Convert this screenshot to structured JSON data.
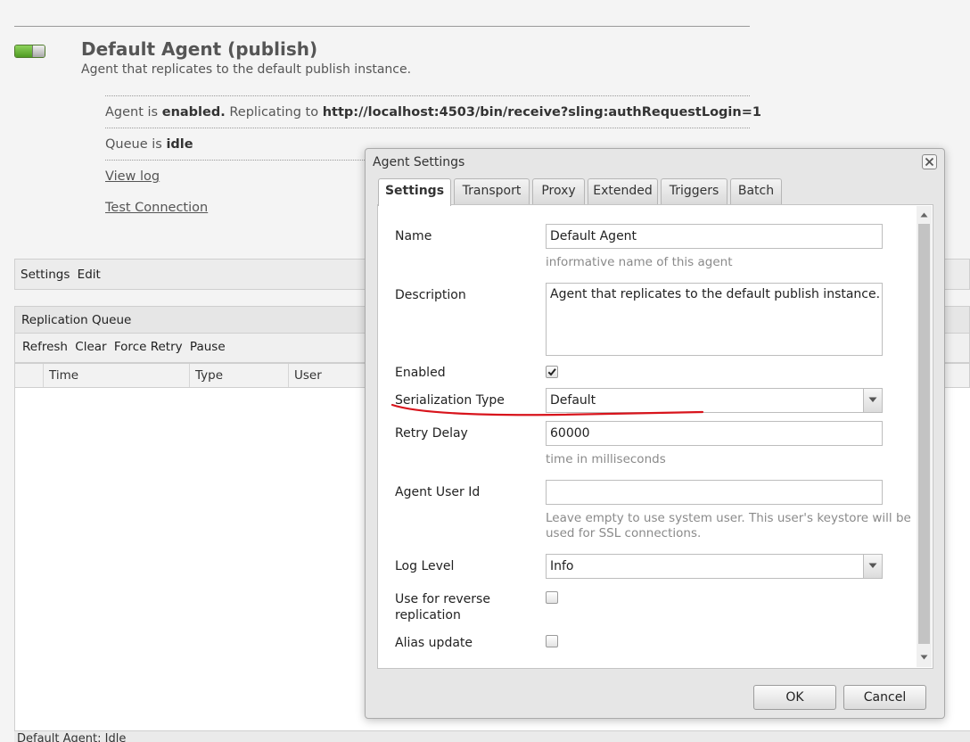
{
  "agent": {
    "title": "Default Agent (publish)",
    "description": "Agent that replicates to the default publish instance.",
    "toggle_state": "enabled"
  },
  "status": {
    "agent_is": "Agent is ",
    "enabled_text": "enabled.",
    "replicating_to": " Replicating to ",
    "url": "http://localhost:4503/bin/receive?sling:authRequestLogin=1",
    "queue_is": "Queue is ",
    "queue_state": "idle",
    "view_log": "View log",
    "test_connection": "Test Connection"
  },
  "settings_bar": {
    "settings": "Settings",
    "edit": "Edit"
  },
  "replication_queue": {
    "title": "Replication Queue",
    "toolbar": [
      "Refresh",
      "Clear",
      "Force Retry",
      "Pause"
    ],
    "columns": [
      "Time",
      "Type",
      "User"
    ]
  },
  "status_bar": "Default Agent: Idle",
  "dialog": {
    "title": "Agent Settings",
    "tabs": [
      "Settings",
      "Transport",
      "Proxy",
      "Extended",
      "Triggers",
      "Batch"
    ],
    "active_tab": "Settings",
    "fields": {
      "name": {
        "label": "Name",
        "value": "Default Agent",
        "hint": "informative name of this agent"
      },
      "description": {
        "label": "Description",
        "value": "Agent that replicates to the default publish instance."
      },
      "enabled": {
        "label": "Enabled",
        "checked": true
      },
      "serialization_type": {
        "label": "Serialization Type",
        "value": "Default"
      },
      "retry_delay": {
        "label": "Retry Delay",
        "value": "60000",
        "hint": "time in milliseconds"
      },
      "agent_user_id": {
        "label": "Agent User Id",
        "value": "",
        "hint_line1": "Leave empty to use system user. This user's keystore will be",
        "hint_line2": "used for SSL connections."
      },
      "log_level": {
        "label": "Log Level",
        "value": "Info"
      },
      "reverse_replication": {
        "label_line1": "Use for reverse",
        "label_line2": "replication",
        "checked": false
      },
      "alias_update": {
        "label": "Alias update",
        "checked": false
      }
    },
    "buttons": {
      "ok": "OK",
      "cancel": "Cancel"
    }
  },
  "colors": {
    "annotation_red": "#d8141c",
    "toggle_green": "#5fae2e"
  }
}
